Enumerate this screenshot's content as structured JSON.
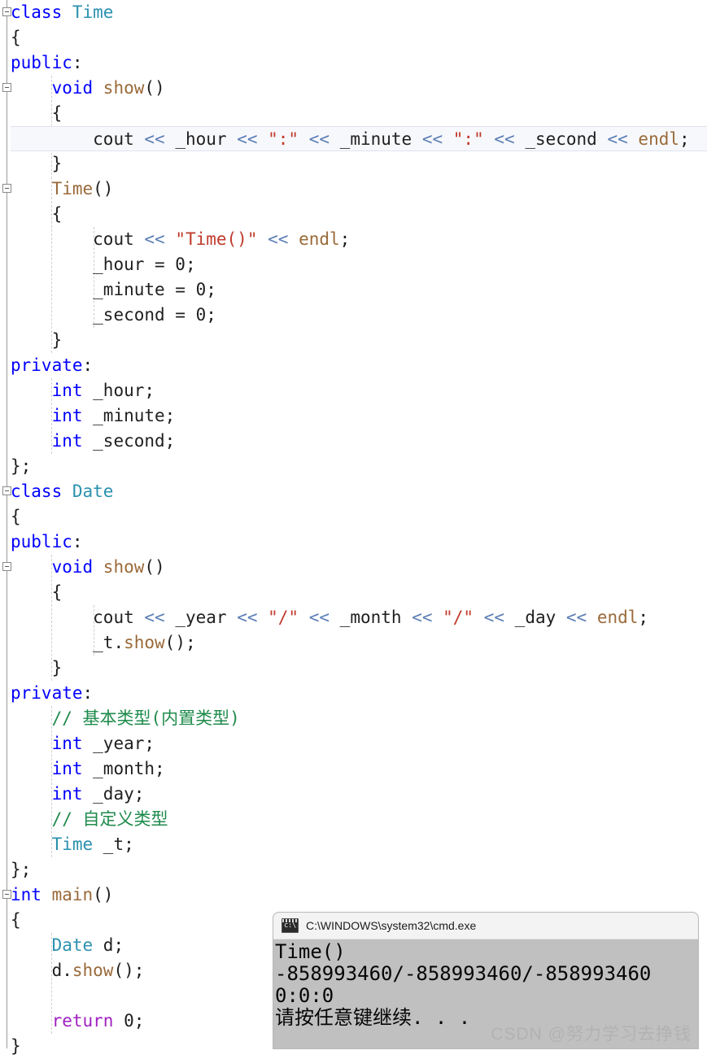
{
  "editor": {
    "language": "cpp",
    "current_line_index": 5,
    "colors": {
      "background": "#ffffff",
      "keyword": "#0000ff",
      "control_keyword": "#a020c0",
      "type": "#2b91af",
      "function": "#9a6a3a",
      "string": "#c0392b",
      "operator": "#5b7fb5",
      "comment": "#1f8b4c",
      "plain": "#1f1f1f",
      "current_line_background": "#f7f8fc"
    },
    "lines": [
      {
        "indent": 0,
        "fold": true,
        "tokens": [
          {
            "t": "class ",
            "c": "kw"
          },
          {
            "t": "Time",
            "c": "type"
          }
        ]
      },
      {
        "indent": 0,
        "fold": false,
        "tokens": [
          {
            "t": "{",
            "c": "plain"
          }
        ]
      },
      {
        "indent": 0,
        "fold": false,
        "tokens": [
          {
            "t": "public",
            "c": "kw"
          },
          {
            "t": ":",
            "c": "plain"
          }
        ]
      },
      {
        "indent": 1,
        "fold": true,
        "tokens": [
          {
            "t": "void ",
            "c": "kw"
          },
          {
            "t": "show",
            "c": "fn"
          },
          {
            "t": "()",
            "c": "plain"
          }
        ]
      },
      {
        "indent": 1,
        "fold": false,
        "tokens": [
          {
            "t": "{",
            "c": "plain"
          }
        ]
      },
      {
        "indent": 2,
        "fold": false,
        "tokens": [
          {
            "t": "cout ",
            "c": "plain"
          },
          {
            "t": "<<",
            "c": "op"
          },
          {
            "t": " _hour ",
            "c": "plain"
          },
          {
            "t": "<<",
            "c": "op"
          },
          {
            "t": " ",
            "c": "plain"
          },
          {
            "t": "\":\"",
            "c": "str"
          },
          {
            "t": " ",
            "c": "plain"
          },
          {
            "t": "<<",
            "c": "op"
          },
          {
            "t": " _minute ",
            "c": "plain"
          },
          {
            "t": "<<",
            "c": "op"
          },
          {
            "t": " ",
            "c": "plain"
          },
          {
            "t": "\":\"",
            "c": "str"
          },
          {
            "t": " ",
            "c": "plain"
          },
          {
            "t": "<<",
            "c": "op"
          },
          {
            "t": " _second ",
            "c": "plain"
          },
          {
            "t": "<<",
            "c": "op"
          },
          {
            "t": " ",
            "c": "plain"
          },
          {
            "t": "endl",
            "c": "fn"
          },
          {
            "t": ";",
            "c": "plain"
          }
        ]
      },
      {
        "indent": 1,
        "fold": false,
        "tokens": [
          {
            "t": "}",
            "c": "plain"
          }
        ]
      },
      {
        "indent": 1,
        "fold": true,
        "tokens": [
          {
            "t": "Time",
            "c": "fn"
          },
          {
            "t": "()",
            "c": "plain"
          }
        ]
      },
      {
        "indent": 1,
        "fold": false,
        "tokens": [
          {
            "t": "{",
            "c": "plain"
          }
        ]
      },
      {
        "indent": 2,
        "fold": false,
        "tokens": [
          {
            "t": "cout ",
            "c": "plain"
          },
          {
            "t": "<<",
            "c": "op"
          },
          {
            "t": " ",
            "c": "plain"
          },
          {
            "t": "\"Time()\"",
            "c": "str"
          },
          {
            "t": " ",
            "c": "plain"
          },
          {
            "t": "<<",
            "c": "op"
          },
          {
            "t": " ",
            "c": "plain"
          },
          {
            "t": "endl",
            "c": "fn"
          },
          {
            "t": ";",
            "c": "plain"
          }
        ]
      },
      {
        "indent": 2,
        "fold": false,
        "tokens": [
          {
            "t": "_hour = 0;",
            "c": "plain"
          }
        ]
      },
      {
        "indent": 2,
        "fold": false,
        "tokens": [
          {
            "t": "_minute = 0;",
            "c": "plain"
          }
        ]
      },
      {
        "indent": 2,
        "fold": false,
        "tokens": [
          {
            "t": "_second = 0;",
            "c": "plain"
          }
        ]
      },
      {
        "indent": 1,
        "fold": false,
        "tokens": [
          {
            "t": "}",
            "c": "plain"
          }
        ]
      },
      {
        "indent": 0,
        "fold": false,
        "tokens": [
          {
            "t": "private",
            "c": "kw"
          },
          {
            "t": ":",
            "c": "plain"
          }
        ]
      },
      {
        "indent": 1,
        "fold": false,
        "tokens": [
          {
            "t": "int",
            "c": "kw"
          },
          {
            "t": " _hour;",
            "c": "plain"
          }
        ]
      },
      {
        "indent": 1,
        "fold": false,
        "tokens": [
          {
            "t": "int",
            "c": "kw"
          },
          {
            "t": " _minute;",
            "c": "plain"
          }
        ]
      },
      {
        "indent": 1,
        "fold": false,
        "tokens": [
          {
            "t": "int",
            "c": "kw"
          },
          {
            "t": " _second;",
            "c": "plain"
          }
        ]
      },
      {
        "indent": 0,
        "fold": false,
        "tokens": [
          {
            "t": "};",
            "c": "plain"
          }
        ]
      },
      {
        "indent": 0,
        "fold": true,
        "tokens": [
          {
            "t": "class ",
            "c": "kw"
          },
          {
            "t": "Date",
            "c": "type"
          }
        ]
      },
      {
        "indent": 0,
        "fold": false,
        "tokens": [
          {
            "t": "{",
            "c": "plain"
          }
        ]
      },
      {
        "indent": 0,
        "fold": false,
        "tokens": [
          {
            "t": "public",
            "c": "kw"
          },
          {
            "t": ":",
            "c": "plain"
          }
        ]
      },
      {
        "indent": 1,
        "fold": true,
        "tokens": [
          {
            "t": "void ",
            "c": "kw"
          },
          {
            "t": "show",
            "c": "fn"
          },
          {
            "t": "()",
            "c": "plain"
          }
        ]
      },
      {
        "indent": 1,
        "fold": false,
        "tokens": [
          {
            "t": "{",
            "c": "plain"
          }
        ]
      },
      {
        "indent": 2,
        "fold": false,
        "tokens": [
          {
            "t": "cout ",
            "c": "plain"
          },
          {
            "t": "<<",
            "c": "op"
          },
          {
            "t": " _year ",
            "c": "plain"
          },
          {
            "t": "<<",
            "c": "op"
          },
          {
            "t": " ",
            "c": "plain"
          },
          {
            "t": "\"/\"",
            "c": "str"
          },
          {
            "t": " ",
            "c": "plain"
          },
          {
            "t": "<<",
            "c": "op"
          },
          {
            "t": " _month ",
            "c": "plain"
          },
          {
            "t": "<<",
            "c": "op"
          },
          {
            "t": " ",
            "c": "plain"
          },
          {
            "t": "\"/\"",
            "c": "str"
          },
          {
            "t": " ",
            "c": "plain"
          },
          {
            "t": "<<",
            "c": "op"
          },
          {
            "t": " _day ",
            "c": "plain"
          },
          {
            "t": "<<",
            "c": "op"
          },
          {
            "t": " ",
            "c": "plain"
          },
          {
            "t": "endl",
            "c": "fn"
          },
          {
            "t": ";",
            "c": "plain"
          }
        ]
      },
      {
        "indent": 2,
        "fold": false,
        "tokens": [
          {
            "t": "_t.",
            "c": "plain"
          },
          {
            "t": "show",
            "c": "fn"
          },
          {
            "t": "();",
            "c": "plain"
          }
        ]
      },
      {
        "indent": 1,
        "fold": false,
        "tokens": [
          {
            "t": "}",
            "c": "plain"
          }
        ]
      },
      {
        "indent": 0,
        "fold": false,
        "tokens": [
          {
            "t": "private",
            "c": "kw"
          },
          {
            "t": ":",
            "c": "plain"
          }
        ]
      },
      {
        "indent": 1,
        "fold": false,
        "tokens": [
          {
            "t": "// 基本类型(内置类型)",
            "c": "cmt"
          }
        ]
      },
      {
        "indent": 1,
        "fold": false,
        "tokens": [
          {
            "t": "int",
            "c": "kw"
          },
          {
            "t": " _year;",
            "c": "plain"
          }
        ]
      },
      {
        "indent": 1,
        "fold": false,
        "tokens": [
          {
            "t": "int",
            "c": "kw"
          },
          {
            "t": " _month;",
            "c": "plain"
          }
        ]
      },
      {
        "indent": 1,
        "fold": false,
        "tokens": [
          {
            "t": "int",
            "c": "kw"
          },
          {
            "t": " _day;",
            "c": "plain"
          }
        ]
      },
      {
        "indent": 1,
        "fold": false,
        "tokens": [
          {
            "t": "// 自定义类型",
            "c": "cmt"
          }
        ]
      },
      {
        "indent": 1,
        "fold": false,
        "tokens": [
          {
            "t": "Time",
            "c": "type"
          },
          {
            "t": " _t;",
            "c": "plain"
          }
        ]
      },
      {
        "indent": 0,
        "fold": false,
        "tokens": [
          {
            "t": "};",
            "c": "plain"
          }
        ]
      },
      {
        "indent": 0,
        "fold": true,
        "tokens": [
          {
            "t": "int ",
            "c": "kw"
          },
          {
            "t": "main",
            "c": "fn"
          },
          {
            "t": "()",
            "c": "plain"
          }
        ]
      },
      {
        "indent": 0,
        "fold": false,
        "tokens": [
          {
            "t": "{",
            "c": "plain"
          }
        ]
      },
      {
        "indent": 1,
        "fold": false,
        "tokens": [
          {
            "t": "Date",
            "c": "type"
          },
          {
            "t": " d;",
            "c": "plain"
          }
        ]
      },
      {
        "indent": 1,
        "fold": false,
        "tokens": [
          {
            "t": "d.",
            "c": "plain"
          },
          {
            "t": "show",
            "c": "fn"
          },
          {
            "t": "();",
            "c": "plain"
          }
        ]
      },
      {
        "indent": 1,
        "fold": false,
        "tokens": []
      },
      {
        "indent": 1,
        "fold": false,
        "tokens": [
          {
            "t": "return",
            "c": "kw-ctrl"
          },
          {
            "t": " 0;",
            "c": "plain"
          }
        ]
      },
      {
        "indent": 0,
        "fold": false,
        "tokens": [
          {
            "t": "}",
            "c": "plain"
          }
        ]
      }
    ]
  },
  "console_window": {
    "title": "C:\\WINDOWS\\system32\\cmd.exe",
    "icon": "cmd-exe-icon",
    "background": "#c0c0c0",
    "output_lines": [
      "Time()",
      "-858993460/-858993460/-858993460",
      "0:0:0",
      "请按任意键继续. . ."
    ]
  },
  "watermark": {
    "text": "CSDN @努力学习去挣钱"
  }
}
